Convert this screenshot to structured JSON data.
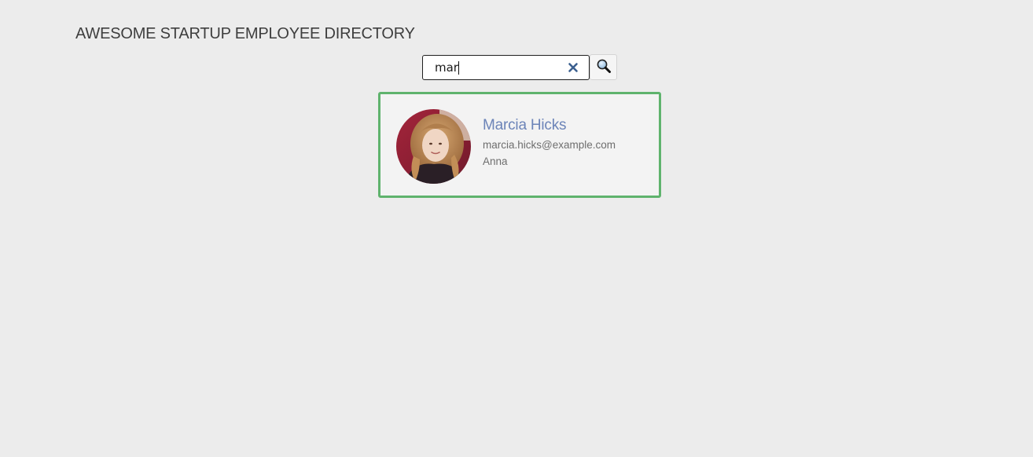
{
  "header": {
    "title": "AWESOME STARTUP EMPLOYEE DIRECTORY"
  },
  "search": {
    "value": "mar",
    "clear_icon": "close-icon",
    "submit_icon": "magnifier-icon"
  },
  "results": [
    {
      "name": "Marcia Hicks",
      "email": "marcia.hicks@example.com",
      "city": "Anna",
      "avatar_icon": "avatar-photo"
    }
  ],
  "colors": {
    "background": "#ececec",
    "card_border_active": "#5fb36d",
    "name": "#6c84b8",
    "clear_icon": "#3b5f8f"
  }
}
